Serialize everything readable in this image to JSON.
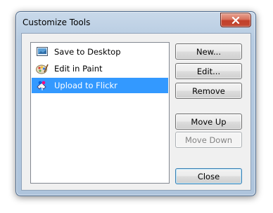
{
  "window": {
    "title": "Customize Tools"
  },
  "list": {
    "items": [
      {
        "label": "Save to Desktop",
        "icon": "desktop-icon",
        "selected": false
      },
      {
        "label": "Edit in Paint",
        "icon": "paint-palette-icon",
        "selected": false
      },
      {
        "label": "Upload to Flickr",
        "icon": "flickr-upload-icon",
        "selected": true
      }
    ]
  },
  "buttons": {
    "new_label": "New...",
    "edit_label": "Edit...",
    "remove_label": "Remove",
    "move_up_label": "Move Up",
    "move_down_label": "Move Down",
    "close_label": "Close"
  },
  "colors": {
    "selection": "#3399ff",
    "frame": "#b6cbe1",
    "close_button": "#c2402b"
  }
}
